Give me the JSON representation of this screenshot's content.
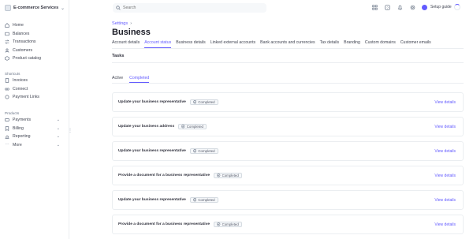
{
  "account": {
    "name": "E-commerce Services ...",
    "logo_icon": "storefront-icon"
  },
  "sidebar": {
    "items": [
      {
        "label": "Home",
        "icon": "home-icon"
      },
      {
        "label": "Balances",
        "icon": "balances-icon"
      },
      {
        "label": "Transactions",
        "icon": "transactions-icon"
      },
      {
        "label": "Customers",
        "icon": "customers-icon"
      },
      {
        "label": "Product catalog",
        "icon": "product-icon"
      }
    ],
    "shortcuts_title": "Shortcuts",
    "shortcuts": [
      {
        "label": "Invoices",
        "icon": "invoice-icon"
      },
      {
        "label": "Connect",
        "icon": "connect-icon"
      },
      {
        "label": "Payment Links",
        "icon": "link-icon"
      }
    ],
    "products_title": "Products",
    "products": [
      {
        "label": "Payments",
        "icon": "payments-icon"
      },
      {
        "label": "Billing",
        "icon": "billing-icon"
      },
      {
        "label": "Reporting",
        "icon": "reporting-icon"
      },
      {
        "label": "More",
        "icon": "more-icon"
      }
    ]
  },
  "search": {
    "placeholder": "Search"
  },
  "topbar": {
    "setup_label": "Setup guide",
    "accent": "#635bff"
  },
  "breadcrumb": {
    "parent": "Settings",
    "separator": "›"
  },
  "page": {
    "title": "Business"
  },
  "tabs": [
    "Account details",
    "Account status",
    "Business details",
    "Linked external accounts",
    "Bank accounts and currencies",
    "Tax details",
    "Branding",
    "Custom domains",
    "Customer emails"
  ],
  "active_tab": "Account status",
  "section": {
    "title": "Tasks"
  },
  "subtabs": [
    "Active",
    "Completed"
  ],
  "active_subtab": "Completed",
  "tasks": [
    {
      "title": "Update your business representative",
      "status": "Completed",
      "action": "View details"
    },
    {
      "title": "Update your business address",
      "status": "Completed",
      "action": "View details"
    },
    {
      "title": "Update your business representative",
      "status": "Completed",
      "action": "View details"
    },
    {
      "title": "Provide a document for a business representative",
      "status": "Completed",
      "action": "View details"
    },
    {
      "title": "Update your business representative",
      "status": "Completed",
      "action": "View details"
    },
    {
      "title": "Provide a document for a business representative",
      "status": "Completed",
      "action": "View details"
    }
  ]
}
